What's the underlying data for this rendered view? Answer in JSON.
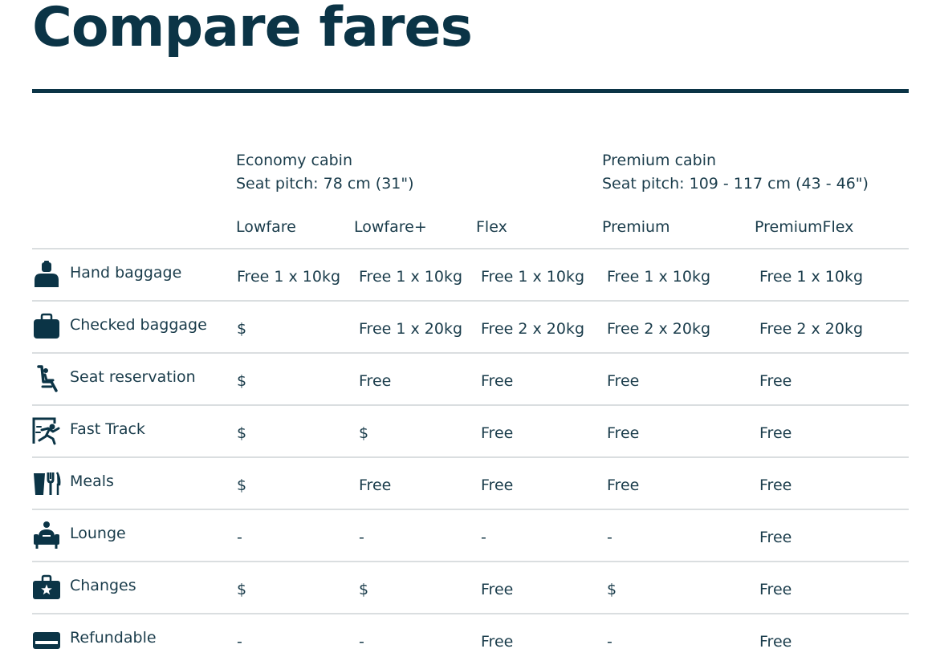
{
  "page": {
    "title": "Compare fares"
  },
  "cabins": [
    {
      "name": "Economy cabin",
      "seat_pitch": "Seat pitch: 78 cm (31\")"
    },
    {
      "name": "Premium cabin",
      "seat_pitch": "Seat pitch: 109 - 117 cm (43 - 46\")"
    }
  ],
  "fares": [
    "Lowfare",
    "Lowfare+",
    "Flex",
    "Premium",
    "PremiumFlex"
  ],
  "rows": [
    {
      "label": "Hand baggage",
      "icon": "hand-baggage-icon",
      "values": [
        "Free 1 x 10kg",
        "Free 1 x 10kg",
        "Free 1 x 10kg",
        "Free 1 x 10kg",
        "Free 1 x 10kg"
      ]
    },
    {
      "label": "Checked baggage",
      "icon": "suitcase-icon",
      "values": [
        "$",
        "Free 1 x 20kg",
        "Free 2 x 20kg",
        "Free 2 x 20kg",
        "Free 2 x 20kg"
      ]
    },
    {
      "label": "Seat reservation",
      "icon": "seat-icon",
      "values": [
        "$",
        "Free",
        "Free",
        "Free",
        "Free"
      ]
    },
    {
      "label": "Fast Track",
      "icon": "fast-track-icon",
      "values": [
        "$",
        "$",
        "Free",
        "Free",
        "Free"
      ]
    },
    {
      "label": "Meals",
      "icon": "meal-icon",
      "values": [
        "$",
        "Free",
        "Free",
        "Free",
        "Free"
      ]
    },
    {
      "label": "Lounge",
      "icon": "lounge-icon",
      "values": [
        "-",
        "-",
        "-",
        "-",
        "Free"
      ]
    },
    {
      "label": "Changes",
      "icon": "changes-briefcase-icon",
      "values": [
        "$",
        "$",
        "Free",
        "$",
        "Free"
      ]
    },
    {
      "label": "Refundable",
      "icon": "refund-card-icon",
      "values": [
        "-",
        "-",
        "Free",
        "-",
        "Free"
      ]
    }
  ],
  "colors": {
    "text": "#0b3446",
    "icon": "#0b3446",
    "rule": "#dadee0"
  }
}
